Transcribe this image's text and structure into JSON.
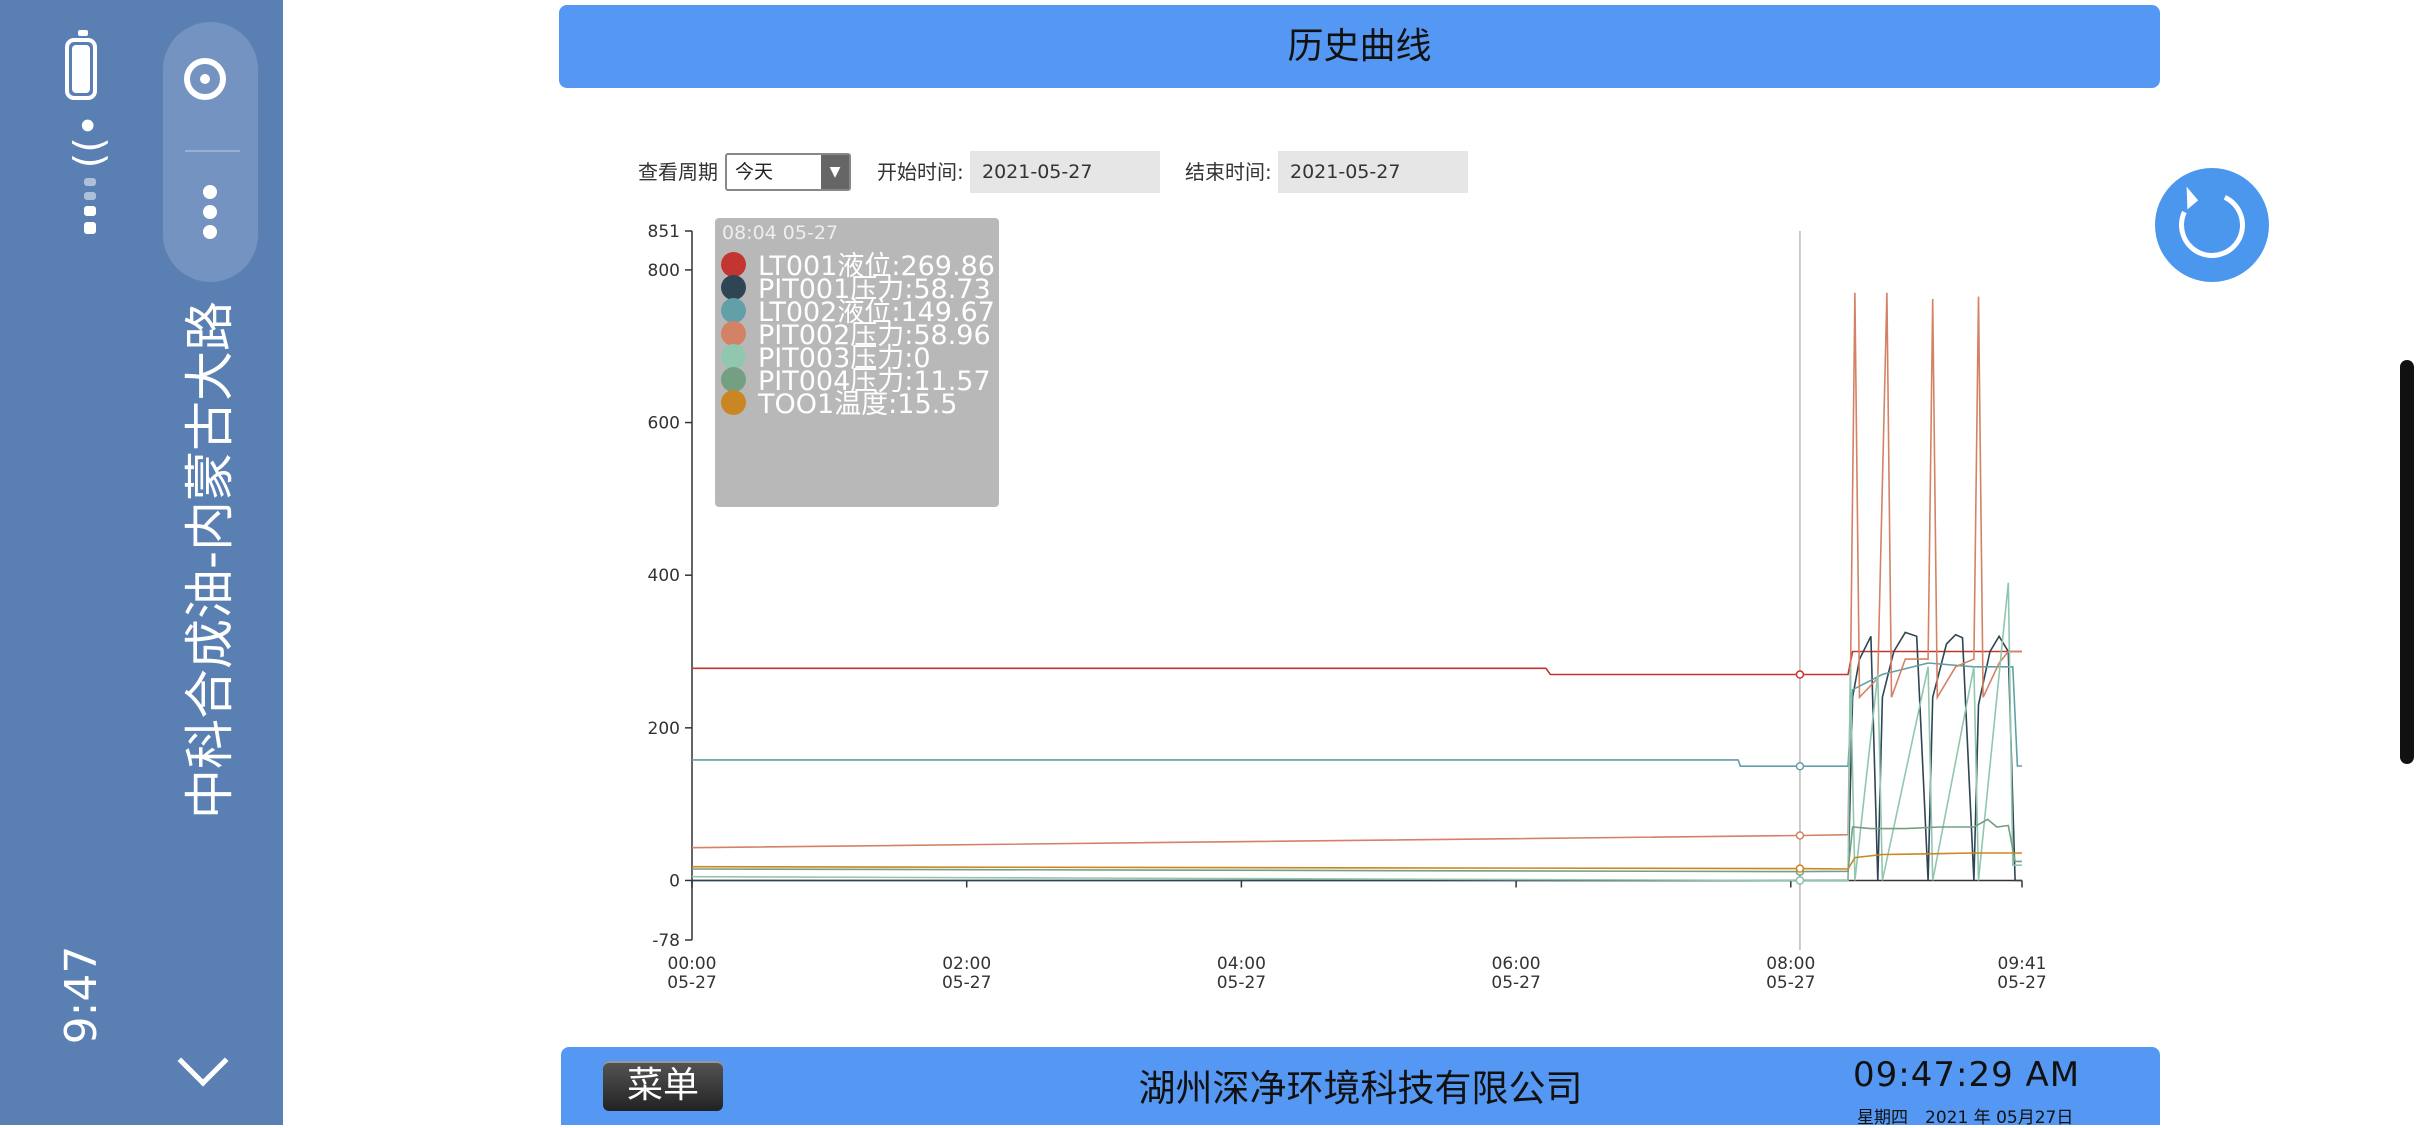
{
  "status_bar": {
    "time": "9:47",
    "title": "中科合成油-内蒙古大路"
  },
  "header": {
    "title": "历史曲线"
  },
  "controls": {
    "period_label": "查看周期",
    "period_value": "今天",
    "start_label": "开始时间:",
    "start_value": "2021-05-27",
    "end_label": "结束时间:",
    "end_value": "2021-05-27"
  },
  "tooltip": {
    "title": "08:04 05-27",
    "rows": [
      {
        "label": "LT001液位:269.86",
        "color": "#c23531"
      },
      {
        "label": "PIT001压力:58.73",
        "color": "#2f4554"
      },
      {
        "label": "LT002液位:149.67",
        "color": "#61a0a8"
      },
      {
        "label": "PIT002压力:58.96",
        "color": "#d48265"
      },
      {
        "label": "PIT003压力:0",
        "color": "#91c7ae"
      },
      {
        "label": "PIT004压力:11.57",
        "color": "#749f83"
      },
      {
        "label": "TOO1温度:15.5",
        "color": "#ca8622"
      }
    ]
  },
  "chart_data": {
    "type": "line",
    "y_ticks": [
      -78,
      0,
      200,
      400,
      600,
      800,
      851
    ],
    "ylim": [
      -78,
      851
    ],
    "x_tick_labels": [
      {
        "time": "00:00",
        "date": "05-27"
      },
      {
        "time": "02:00",
        "date": "05-27"
      },
      {
        "time": "04:00",
        "date": "05-27"
      },
      {
        "time": "06:00",
        "date": "05-27"
      },
      {
        "time": "08:00",
        "date": "05-27"
      },
      {
        "time": "09:41",
        "date": "05-27"
      }
    ],
    "x_tick_minutes": [
      0,
      120,
      240,
      360,
      480,
      581
    ],
    "xlim_minutes": [
      0,
      581
    ],
    "cursor_minutes": 484,
    "series": [
      {
        "name": "LT001液位",
        "color": "#c23531",
        "points": [
          [
            0,
            278
          ],
          [
            373,
            278
          ],
          [
            375,
            269.86
          ],
          [
            484,
            269.86
          ],
          [
            505,
            269.86
          ],
          [
            507,
            300
          ],
          [
            581,
            300
          ]
        ]
      },
      {
        "name": "PIT001压力",
        "color": "#2f4554",
        "points": [
          [
            0,
            0
          ],
          [
            484,
            0
          ],
          [
            505,
            0
          ],
          [
            507,
            240
          ],
          [
            510,
            290
          ],
          [
            515,
            320
          ],
          [
            518,
            0
          ],
          [
            520,
            240
          ],
          [
            525,
            300
          ],
          [
            530,
            325
          ],
          [
            535,
            320
          ],
          [
            540,
            0
          ],
          [
            542,
            240
          ],
          [
            548,
            310
          ],
          [
            552,
            322
          ],
          [
            555,
            318
          ],
          [
            560,
            0
          ],
          [
            562,
            230
          ],
          [
            567,
            300
          ],
          [
            571,
            320
          ],
          [
            575,
            300
          ],
          [
            578,
            0
          ],
          [
            581,
            0
          ]
        ]
      },
      {
        "name": "LT002液位",
        "color": "#61a0a8",
        "points": [
          [
            0,
            158
          ],
          [
            457,
            158
          ],
          [
            458,
            149.67
          ],
          [
            484,
            149.67
          ],
          [
            505,
            149.67
          ],
          [
            507,
            250
          ],
          [
            520,
            270
          ],
          [
            540,
            285
          ],
          [
            560,
            280
          ],
          [
            577,
            280
          ],
          [
            579,
            150
          ],
          [
            581,
            150
          ]
        ]
      },
      {
        "name": "PIT002压力",
        "color": "#d48265",
        "points": [
          [
            0,
            43
          ],
          [
            484,
            58.96
          ],
          [
            505,
            60
          ],
          [
            506,
            250
          ],
          [
            508,
            770
          ],
          [
            510,
            240
          ],
          [
            518,
            265
          ],
          [
            522,
            770
          ],
          [
            524,
            240
          ],
          [
            530,
            290
          ],
          [
            540,
            290
          ],
          [
            542,
            762
          ],
          [
            544,
            240
          ],
          [
            552,
            280
          ],
          [
            560,
            290
          ],
          [
            562,
            765
          ],
          [
            564,
            240
          ],
          [
            571,
            285
          ],
          [
            575,
            300
          ],
          [
            579,
            300
          ],
          [
            581,
            300
          ]
        ]
      },
      {
        "name": "PIT003压力",
        "color": "#91c7ae",
        "points": [
          [
            0,
            5
          ],
          [
            484,
            0
          ],
          [
            505,
            0
          ],
          [
            506,
            280
          ],
          [
            508,
            0
          ],
          [
            518,
            270
          ],
          [
            520,
            0
          ],
          [
            540,
            280
          ],
          [
            542,
            0
          ],
          [
            560,
            280
          ],
          [
            562,
            0
          ],
          [
            575,
            390
          ],
          [
            577,
            20
          ],
          [
            581,
            20
          ]
        ]
      },
      {
        "name": "PIT004压力",
        "color": "#749f83",
        "points": [
          [
            0,
            15
          ],
          [
            484,
            11.57
          ],
          [
            505,
            12
          ],
          [
            507,
            70
          ],
          [
            515,
            68
          ],
          [
            530,
            68
          ],
          [
            545,
            70
          ],
          [
            560,
            70
          ],
          [
            566,
            80
          ],
          [
            570,
            70
          ],
          [
            575,
            72
          ],
          [
            578,
            25
          ],
          [
            581,
            25
          ]
        ]
      },
      {
        "name": "TOO1温度",
        "color": "#ca8622",
        "points": [
          [
            0,
            18
          ],
          [
            484,
            15.5
          ],
          [
            505,
            15
          ],
          [
            508,
            30
          ],
          [
            520,
            34
          ],
          [
            540,
            35
          ],
          [
            560,
            36
          ],
          [
            575,
            36
          ],
          [
            577,
            36
          ],
          [
            581,
            36
          ]
        ]
      }
    ]
  },
  "footer": {
    "menu_label": "菜单",
    "company": "湖州深净环境科技有限公司",
    "clock": "09:47:29 AM",
    "date_line": "星期四　2021 年 05月27日"
  }
}
